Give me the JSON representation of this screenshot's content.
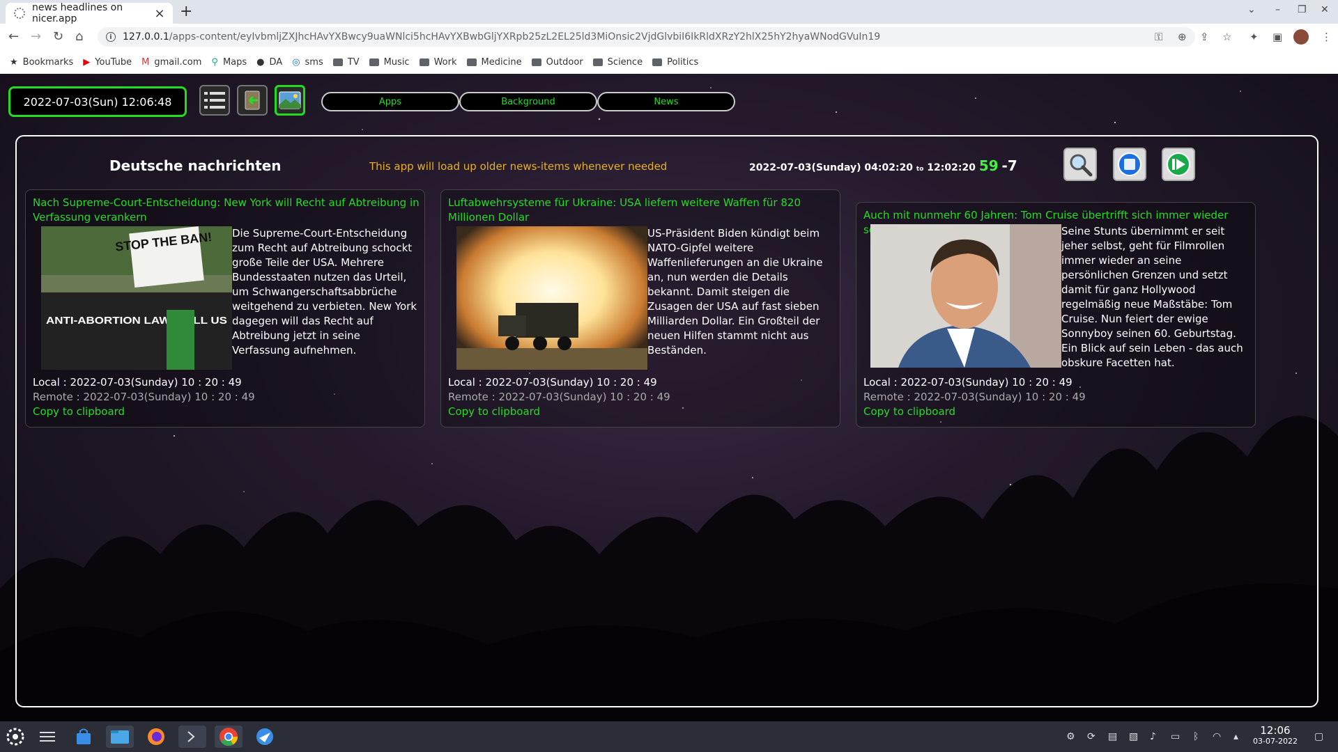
{
  "browser": {
    "tab_title": "news headlines on nicer.app",
    "url_host": "127.0.0.1",
    "url_path": "/apps-content/eyIvbmljZXJhcHAvYXBwcy9uaWNlci5hcHAvYXBwbGljYXRpb25zL2EL25ld3MiOnsic2VjdGlvbiI6IkRldXRzY2hlX25hY2hyaWNodGVuIn19",
    "bookmarks": [
      "Bookmarks",
      "YouTube",
      "gmail.com",
      "Maps",
      "DA",
      "sms",
      "TV",
      "Music",
      "Work",
      "Medicine",
      "Outdoor",
      "Science",
      "Politics"
    ]
  },
  "header": {
    "datetime": "2022-07-03(Sun) 12:06:48",
    "menu_apps": "Apps",
    "menu_background": "Background",
    "menu_news": "News"
  },
  "panel": {
    "title": "Deutsche nachrichten",
    "note": "This app will load up older news-items whenever needed",
    "range_from": "2022-07-03(Sunday) 04:02:20",
    "range_to_word": "to",
    "range_to": "12:02:20",
    "count": "59",
    "offset": "-7"
  },
  "articles": [
    {
      "title": "Nach Supreme-Court-Entscheidung: New York will Recht auf Abtreibung in Verfassung verankern",
      "text": "Die Supreme-Court-Entscheidung zum Recht auf Abtreibung schockt große Teile der USA. Mehrere Bundesstaaten nutzen das Urteil, um Schwangerschaftsabbrüche weitgehend zu verbieten. New York dagegen will das Recht auf Abtreibung jetzt in seine Verfassung aufnehmen.",
      "image_sign": "STOP THE BAN!",
      "image_banner": "ANTI-ABORTION LAWS KILL US",
      "local": "Local : 2022-07-03(Sunday) 10 : 20 : 49",
      "remote": "Remote : 2022-07-03(Sunday) 10 : 20 : 49",
      "copy": "Copy to clipboard"
    },
    {
      "title": "Luftabwehrsysteme für Ukraine: USA liefern weitere Waffen für 820 Millionen Dollar",
      "text": "US-Präsident Biden kündigt beim NATO-Gipfel weitere Waffenlieferungen an die Ukraine an, nun werden die Details bekannt. Damit steigen die Zusagen der USA auf fast sieben Milliarden Dollar. Ein Großteil der neuen Hilfen stammt nicht aus Beständen.",
      "local": "Local : 2022-07-03(Sunday) 10 : 20 : 49",
      "remote": "Remote : 2022-07-03(Sunday) 10 : 20 : 49",
      "copy": "Copy to clipboard"
    },
    {
      "title": "Auch mit nunmehr 60 Jahren: Tom Cruise übertrifft sich immer wieder selbst",
      "text": "Seine Stunts übernimmt er seit jeher selbst, geht für Filmrollen immer wieder an seine persönlichen Grenzen und setzt damit für ganz Hollywood regelmäßig neue Maßstäbe: Tom Cruise. Nun feiert der ewige Sonnyboy seinen 60. Geburtstag. Ein Blick auf sein Leben - das auch obskure Facetten hat.",
      "local": "Local : 2022-07-03(Sunday) 10 : 20 : 49",
      "remote": "Remote : 2022-07-03(Sunday) 10 : 20 : 49",
      "copy": "Copy to clipboard"
    }
  ],
  "taskbar": {
    "time": "12:06",
    "date": "03-07-2022"
  },
  "icons": {
    "menu": "list-icon",
    "back": "back-arrow-icon",
    "background": "landscape-icon",
    "search": "magnifier-icon",
    "stop": "stop-icon",
    "play": "play-icon"
  },
  "colors": {
    "accent": "#22dd22",
    "note": "#e8b020"
  }
}
